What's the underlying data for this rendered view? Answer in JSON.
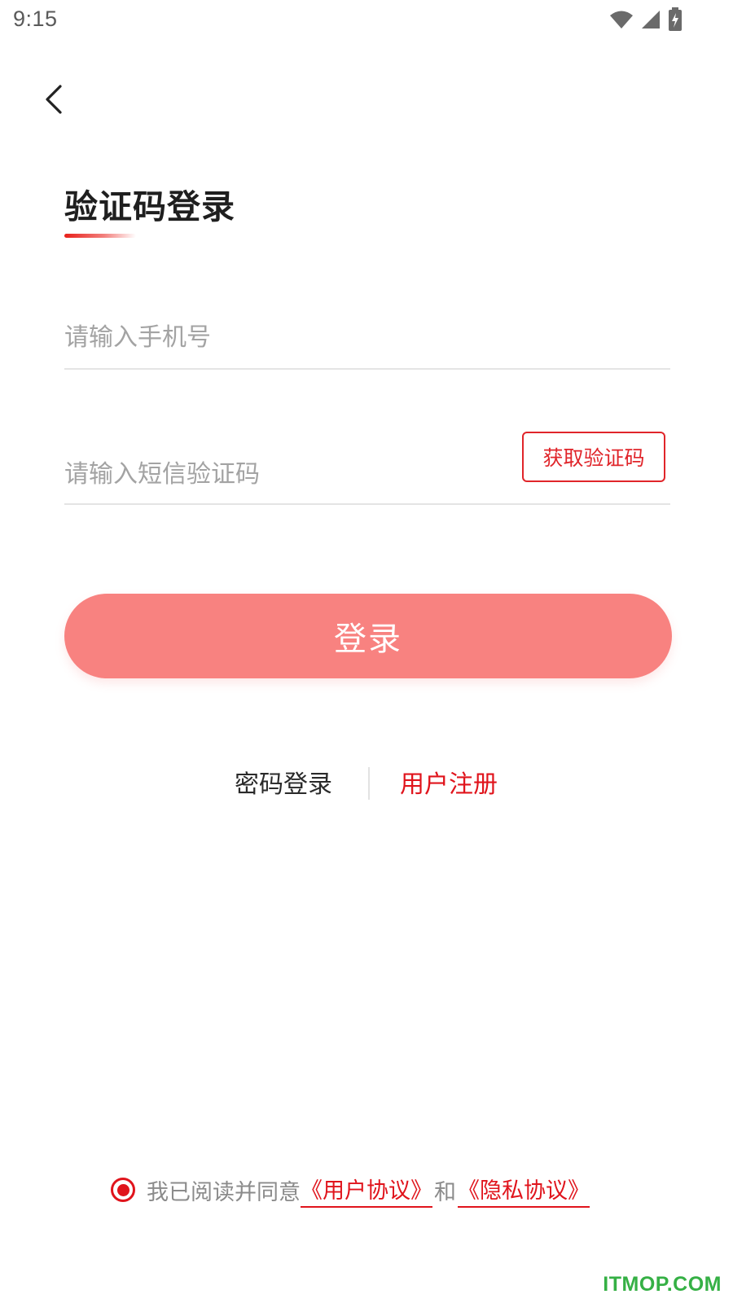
{
  "status_bar": {
    "time": "9:15",
    "icons": [
      "wifi-icon",
      "cellular-signal-icon",
      "battery-charging-icon"
    ]
  },
  "header": {
    "back_icon": "chevron-left-icon"
  },
  "title": "验证码登录",
  "form": {
    "phone_placeholder": "请输入手机号",
    "phone_value": "",
    "code_placeholder": "请输入短信验证码",
    "code_value": "",
    "get_code_label": "获取验证码"
  },
  "login_button": "登录",
  "switch_links": {
    "password_login": "密码登录",
    "register": "用户注册"
  },
  "agreement": {
    "prefix": "我已阅读并同意",
    "user_agreement": "《用户协议》",
    "and": "和",
    "privacy_agreement": "《隐私协议》",
    "checked": true
  },
  "watermark": "ITMOP.COM",
  "colors": {
    "accent": "#e0141c",
    "button": "#f88280",
    "placeholder": "#a3a3a3",
    "watermark": "#35b045"
  }
}
